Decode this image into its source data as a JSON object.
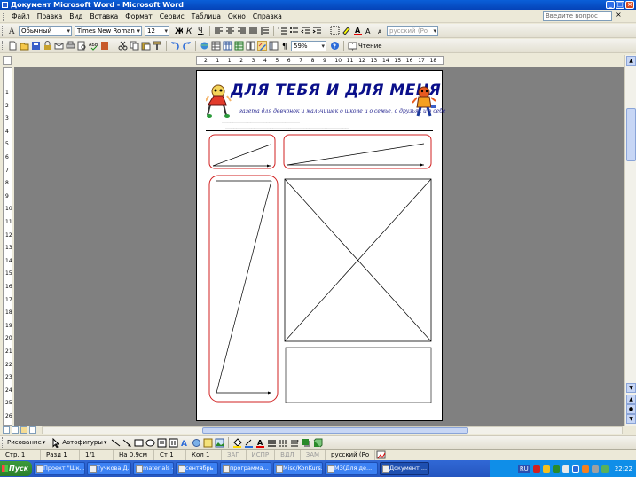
{
  "window": {
    "title": "Документ Microsoft Word - Microsoft Word",
    "buttons": [
      "_",
      "□",
      "×"
    ]
  },
  "menu": {
    "items": [
      "Файл",
      "Правка",
      "Вид",
      "Вставка",
      "Формат",
      "Сервис",
      "Таблица",
      "Окно",
      "Справка"
    ],
    "help_placeholder": "Введите вопрос",
    "close": "×"
  },
  "toolbar1": {
    "style": "Обычный",
    "font": "Times New Roman",
    "size": "12",
    "language": "русский (Ро"
  },
  "toolbar2": {
    "zoom": "59%",
    "reading": "Чтение"
  },
  "ruler": {
    "h_ticks": [
      "2",
      "1",
      "1",
      "2",
      "3",
      "4",
      "5",
      "6",
      "7",
      "8",
      "9",
      "10",
      "11",
      "12",
      "13",
      "14",
      "15",
      "16",
      "17",
      "18"
    ],
    "v_ticks": [
      "1",
      "2",
      "3",
      "4",
      "5",
      "6",
      "7",
      "8",
      "9",
      "10",
      "11",
      "12",
      "13",
      "14",
      "15",
      "16",
      "17",
      "18",
      "19",
      "20",
      "21",
      "22",
      "23",
      "24",
      "25",
      "26"
    ]
  },
  "document": {
    "masthead_title": "ДЛЯ ТЕБЯ  И  ДЛЯ МЕНЯ",
    "masthead_subtitle": "газета для девчонок и мальчишек о школе и о семье, о друзьях и о себе"
  },
  "drawing": {
    "draw_label": "Рисование",
    "autoshapes_label": "Автофигуры"
  },
  "status": {
    "page": "Стр. 1",
    "section": "Разд 1",
    "pages": "1/1",
    "at": "На 0,9см",
    "line": "Ст 1",
    "col": "Кол 1",
    "rec": "ЗАП",
    "trk": "ИСПР",
    "ext": "ВДЛ",
    "ovr": "ЗАМ",
    "lang": "русский (Ро"
  },
  "taskbar": {
    "start": "Пуск",
    "tasks": [
      "Проект \"Шк...",
      "Тучкова Д...",
      "materials -...",
      "сентябрь",
      "программа...",
      "Misc/KonKurs...",
      "МЗ(Для де...",
      "Документ ..."
    ],
    "lang": "RU",
    "time": "22:22"
  }
}
